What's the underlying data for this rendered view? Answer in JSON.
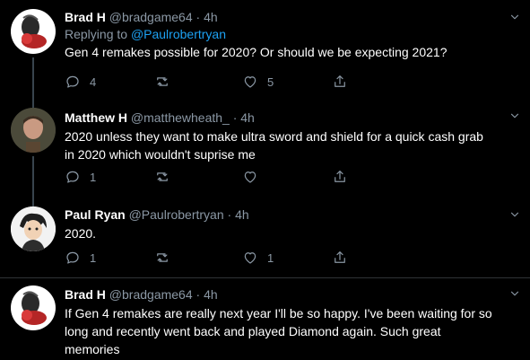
{
  "tweets": [
    {
      "name": "Brad H",
      "meta": "@bradgame64 · 4h",
      "replying_prefix": "Replying to ",
      "replying_handle": "@Paulrobertryan",
      "text_lines": [
        "Gen 4 remakes possible for 2020? Or should we be expecting 2021?"
      ],
      "reply_count": "4",
      "retweet_count": "",
      "like_count": "5"
    },
    {
      "name": "Matthew H",
      "meta": "@matthewheath_ · 4h",
      "text_lines": [
        "2020 unless they want to make ultra sword and shield for a quick cash grab",
        "in 2020 which wouldn't suprise me"
      ],
      "reply_count": "1",
      "retweet_count": "",
      "like_count": ""
    },
    {
      "name": "Paul Ryan",
      "meta": "@Paulrobertryan · 4h",
      "text_lines": [
        "2020."
      ],
      "reply_count": "1",
      "retweet_count": "",
      "like_count": "1"
    },
    {
      "name": "Brad H",
      "meta": "@bradgame64 · 4h",
      "text_lines": [
        "If Gen 4 remakes are really next year I'll be so happy. I've been waiting for so",
        "long and recently went back and played Diamond again. Such great",
        "memories"
      ]
    }
  ],
  "icons": {
    "reply": "reply-icon",
    "retweet": "retweet-icon",
    "like": "heart-icon",
    "share": "share-icon",
    "caret": "chevron-down-icon"
  },
  "colors": {
    "background": "#000000",
    "link": "#1da1f2",
    "muted": "#8b98a5",
    "divider": "#2f3336"
  }
}
